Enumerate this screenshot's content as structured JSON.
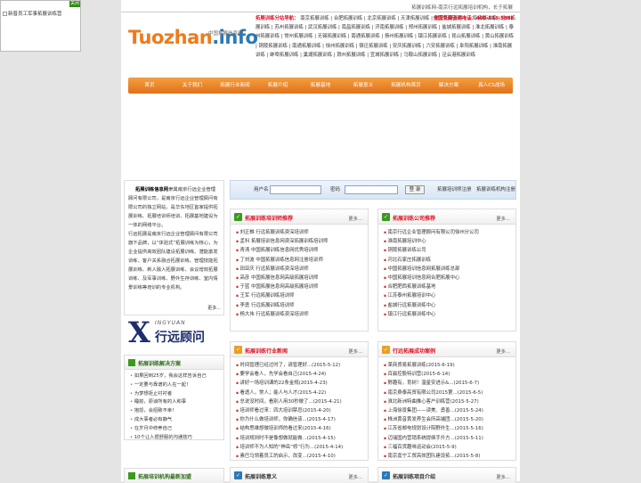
{
  "float_ad": {
    "close_label": "关闭",
    "alt_text": "新普员工军事拓展训练营"
  },
  "topbar": {
    "text": "拓展训练网-南京行远拓展培训机构，长于拓展"
  },
  "logo": {
    "word_a": "Tuozhan",
    "word_b": ".info",
    "tagline": "中国拓展信息网"
  },
  "topnav": {
    "heading": "拓展训练分站导航：",
    "hotline": "全国免费咨询电话：400-618-5808",
    "links": "南京拓展训练 | 合肥拓展训练 | 北京拓展训练 | 天津拓展训练 | 重庆拓展训练 | 上海拓展训练 | 沧州拓展训练 | 苏州拓展训练 | 武汉拓展训练 | 南昌拓展训练 | 济南拓展训练 | 郑州拓展训练 | 盐城拓展训练 | 淮北拓展训练 | 泰州拓展训练 | 常州拓展训练 | 无锡拓展训练 | 南通拓展训练 | 扬州拓展训练 | 镇江拓展训练 | 昆山拓展训练 | 黄山拓展训练 | 铜陵拓展训练 | 南通拓展训练 | 徐州拓展训练 | 宿迁拓展训练 | 安庆拓展训练 | 六安拓展训练 | 阜阳拓展训练 | 淮南拓展训练 | 蚌埠拓展训练 | 巢湖拓展训练 | 滁州拓展训练 | 宣城拓展训练 | 马鞍山拓展训练 | 泾云港拓展训练"
  },
  "mainnav": [
    "首页",
    "关于我们",
    "拓展行业新闻",
    "拓展介绍",
    "拓展基地",
    "拓展意义",
    "拓展机构首页",
    "解决方案",
    "真人CS战场"
  ],
  "intro": {
    "lead": "拓展训练信息网",
    "para1": "隶属南京行远企业管理顾问有限公司，是南京行远企业管理顾问有限公司的独立网站，是华东地区首家提供拓展训练、拓展培训师培训、拓展基地建设为一体的网络平台。",
    "para2": "行远拓展是南京行远企业管理顾问有限公司旗下品牌，以“体验式”拓展训练为核心，为企业提供高效团队建设拓展训练、潜能激发训练、客户关系融合拓展训练、管理技能拓展训练、新人融入拓展训练、会议增效拓展训练、及军事训练、野外生存训练、室内情景训练等培训的专业机构。",
    "more": "更多..."
  },
  "consultant_logo": {
    "mark": "X",
    "sub": "INGYUAN",
    "name": "行远顾问"
  },
  "login": {
    "user_label": "用户名",
    "pass_label": "密码",
    "btn_label": "登 录",
    "register_label": "拓展培训师注册",
    "org_register_label": "拓展训练机构注册"
  },
  "solutions": {
    "title": "拓展训练解决方案",
    "items": [
      "如果回到25岁，我会这样告诉自己",
      "一定要与靠谱的人在一起！",
      "为梦想拒止衬衬者",
      "睡前，原谅所有的人和事",
      "抱怨，会招致不幸！",
      "成大事者必有静气",
      "在岁月中修养自己",
      "10个让人很舒服的沟通技巧"
    ]
  },
  "new_orgs": {
    "title": "拓展培训机构最新加盟"
  },
  "trainers": {
    "title": "拓展训练培训师推荐",
    "more": "更多...",
    "items": [
      "刘正椎 行远拓展训练资深培训师",
      "孟科 拓展培训信息网资深拓展训练培训师",
      "青涛 中国拓展训练信息网优秀培训师",
      "丁刘波 中国拓展训练信息网注册培训师",
      "田亚庆 行远拓展训练资深培训师",
      "高彦 中国拓展信息网高级拓展培训师",
      "于蓝 中国拓展信息网高级拓展培训师",
      "王军 行远拓展训练培训师",
      "李勇 行远拓展训练培训师",
      "杨大伟 行远拓展训练资深培训师"
    ]
  },
  "companies": {
    "title": "拓展训练公司推荐",
    "more": "更多...",
    "items": [
      "南京行远企业管理顾问有限公司徐州分公司",
      "淮南拓展培训中心",
      "铜陵拓展训练公司",
      "河北石家庄拓展训练",
      "中国拓展培训信息网拓展训练总部",
      "中国拓展培训信息网合肥拓展中心",
      "合肥肥西拓展训练基地",
      "江苏泰州拓展培训中心",
      "盐城行远拓展训练中心",
      "镇江行远拓展训练中心"
    ]
  },
  "news": {
    "title": "拓展训练行业新闻",
    "more": "更多...",
    "items": [
      "时间管理已经过时了，请管理好...(2015-5-12)",
      "要学会看人，先学会看自己(2015-4-24)",
      "讲好一场培训课的22条金规(2015-4-23)",
      "看透人，常人；能人与人才(2015-4-22)",
      "总说没时间，看别人用30秒做了...(2015-4-21)",
      "培训师看过来：四大培训禁忌(2015-4-20)",
      "你为什么做培训师，你确信该...(2015-4-17)",
      "结构思维想做培训师的看过来(2015-4-16)",
      "培训规则时不是像想做就能做...(2015-4-15)",
      "培训师不为人知的“神岳”修“行为...(2015-4-14)",
      "素巴马领着员工的启示，改变...(2015-4-10)"
    ]
  },
  "cases": {
    "title": "行远拓展成功案例",
    "more": "更多...",
    "items": [
      "莱商贸易拓展训练(2015-6-19)",
      "百晨控股特训营(2015-6-14)",
      "野趣有，育树！温星安进示&...(2015-6-7)",
      "南京费泰高贸有限公司2015第...(2015-6-5)",
      "淮北新洲特曲推心客户训练营(2015-5-27)",
      "上海徐景集团——读美、勇善...(2015-5-24)",
      "株洲黄音黄发养生会所高端团...(2015-5-20)",
      "江苏省邮电规划设计院野外生...(2015-5-16)",
      "迈瑞国内营销系统提纲手升方...(2015-5-11)",
      "三福百货趣味运动会(2015-5-9)",
      "南京嘉宁工贸高效团队建设拓...(2015-5-8)"
    ]
  },
  "meaning": {
    "title": "拓展训练意义",
    "more": "更多..."
  },
  "projects": {
    "title": "拓展训练项目介绍",
    "more": "更多..."
  },
  "colors": {
    "accent": "#ee7b1a",
    "nav_bg": "#e0701a",
    "icon_green": "#3b9a1e",
    "hot_red": "#dd1122",
    "brand_blue": "#2c79b6"
  }
}
